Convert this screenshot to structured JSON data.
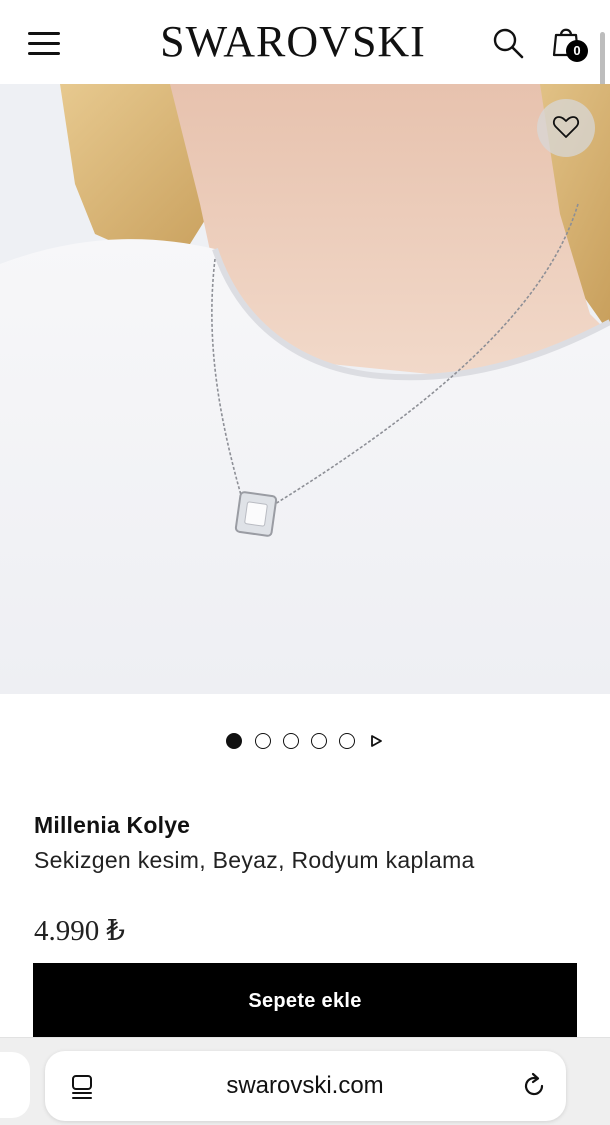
{
  "header": {
    "logo_text": "SWAROVSKI",
    "cart_count": "0"
  },
  "icons": {
    "menu": "hamburger-menu-icon",
    "search": "search-icon",
    "cart": "shopping-bag-icon",
    "wishlist": "heart-icon",
    "carousel_next": "play-triangle-icon",
    "reader": "reader-mode-icon",
    "reload": "reload-icon"
  },
  "carousel": {
    "total_slides": 5,
    "active_index": 0
  },
  "product": {
    "name": "Millenia Kolye",
    "description": "Sekizgen kesim, Beyaz, Rodyum kaplama",
    "price": "4.990 ₺",
    "add_to_cart_label": "Sepete ekle"
  },
  "browser": {
    "url": "swarovski.com"
  },
  "colors": {
    "button_bg": "#000000",
    "button_text": "#ffffff",
    "page_bg": "#ffffff",
    "browser_bar_bg": "#efefef"
  }
}
